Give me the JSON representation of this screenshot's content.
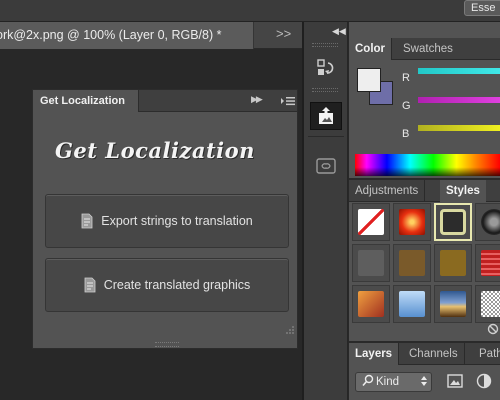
{
  "app": {
    "workspace_button": "Esse"
  },
  "document": {
    "tab_title": "ork@2x.png @ 100% (Layer 0, RGB/8) *",
    "overflow_glyph": ">>"
  },
  "plugin_panel": {
    "tab_label": "Get Localization",
    "heading": "Get Localization",
    "buttons": [
      {
        "label": "Export strings to translation",
        "icon": "page-icon"
      },
      {
        "label": "Create translated graphics",
        "icon": "page-icon"
      }
    ]
  },
  "color_panel": {
    "tabs": [
      "Color",
      "Swatches"
    ],
    "active_tab": "Color",
    "channels": [
      "R",
      "G",
      "B"
    ],
    "foreground": "#eeeeee",
    "background": "#6e6ea8"
  },
  "styles_panel": {
    "tabs": [
      "Adjustments",
      "Styles"
    ],
    "active_tab": "Styles",
    "swatches": [
      {
        "name": "none",
        "color": "#ffffff"
      },
      {
        "name": "red-glow",
        "color": "#e83010"
      },
      {
        "name": "framed",
        "color": "#2c2c2c"
      },
      {
        "name": "chrome",
        "color": "#303030"
      },
      {
        "name": "dark-bevel",
        "color": "#5e5e5e"
      },
      {
        "name": "bronze",
        "color": "#7a5a2a"
      },
      {
        "name": "gold",
        "color": "#8a6a20"
      },
      {
        "name": "red-stripes",
        "color": "#c02020"
      },
      {
        "name": "orange-gradient",
        "color": "#d87028"
      },
      {
        "name": "blue-glass",
        "color": "#70a8e0"
      },
      {
        "name": "sunset",
        "color": "#305890"
      },
      {
        "name": "noise",
        "color": "#cccccc"
      }
    ]
  },
  "layers_panel": {
    "tabs": [
      "Layers",
      "Channels",
      "Path"
    ],
    "active_tab": "Layers",
    "filter_kind": "Kind"
  }
}
